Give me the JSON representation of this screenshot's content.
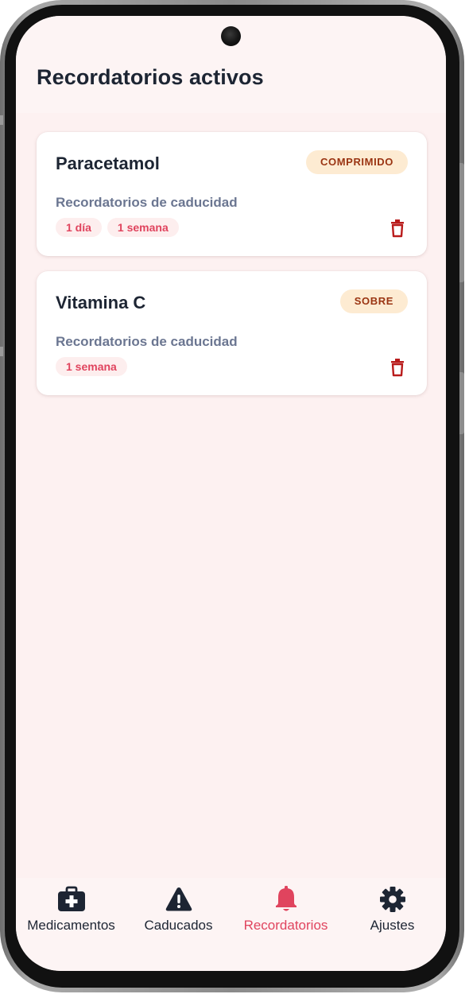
{
  "screen": {
    "title": "Recordatorios activos"
  },
  "reminders": [
    {
      "name": "Paracetamol",
      "type": "COMPRIMIDO",
      "section_label": "Recordatorios de caducidad",
      "chips": [
        "1 día",
        "1 semana"
      ]
    },
    {
      "name": "Vitamina C",
      "type": "SOBRE",
      "section_label": "Recordatorios de caducidad",
      "chips": [
        "1 semana"
      ]
    }
  ],
  "nav": {
    "items": [
      {
        "label": "Medicamentos",
        "icon": "first-aid-kit-icon"
      },
      {
        "label": "Caducados",
        "icon": "warning-icon"
      },
      {
        "label": "Recordatorios",
        "icon": "bell-icon",
        "active": true
      },
      {
        "label": "Ajustes",
        "icon": "gear-icon"
      }
    ]
  },
  "colors": {
    "accent": "#e0445e",
    "badge_bg": "#fdebd2",
    "badge_text": "#9a3412",
    "chip_bg": "#fdeeee",
    "title_text": "#1d2533",
    "muted_text": "#6b7691",
    "screen_bg": "#fdf1f1",
    "delete_icon": "#b91c1c"
  }
}
